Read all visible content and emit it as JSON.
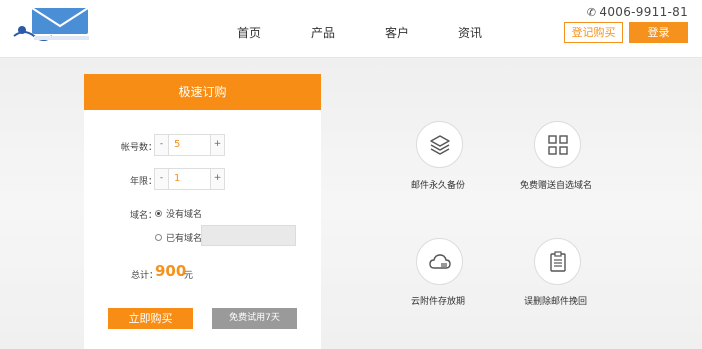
{
  "header": {
    "nav": [
      "首页",
      "产品",
      "客户",
      "资讯"
    ],
    "phone": "4006-9911-81",
    "register_label": "登记购买",
    "login_label": "登录"
  },
  "order": {
    "title": "极速订购",
    "accounts_label": "帐号数：",
    "accounts_value": "5",
    "years_label": "年限：",
    "years_value": "1",
    "domain_label": "域名：",
    "no_domain_label": "没有域名",
    "has_domain_label": "已有域名",
    "total_label": "总计：",
    "total_value": "900",
    "total_unit": "元",
    "buy_label": "立即购买",
    "trial_label": "免费试用7天"
  },
  "features": [
    {
      "label": "邮件永久备份",
      "icon": "layers-icon"
    },
    {
      "label": "免费赠送自选域名",
      "icon": "grid-icon"
    },
    {
      "label": "云附件存放期",
      "icon": "cloud-icon"
    },
    {
      "label": "误删除邮件挽回",
      "icon": "clipboard-icon"
    }
  ],
  "colors": {
    "accent": "#f88d15",
    "trial_button": "#9a9a9a"
  }
}
